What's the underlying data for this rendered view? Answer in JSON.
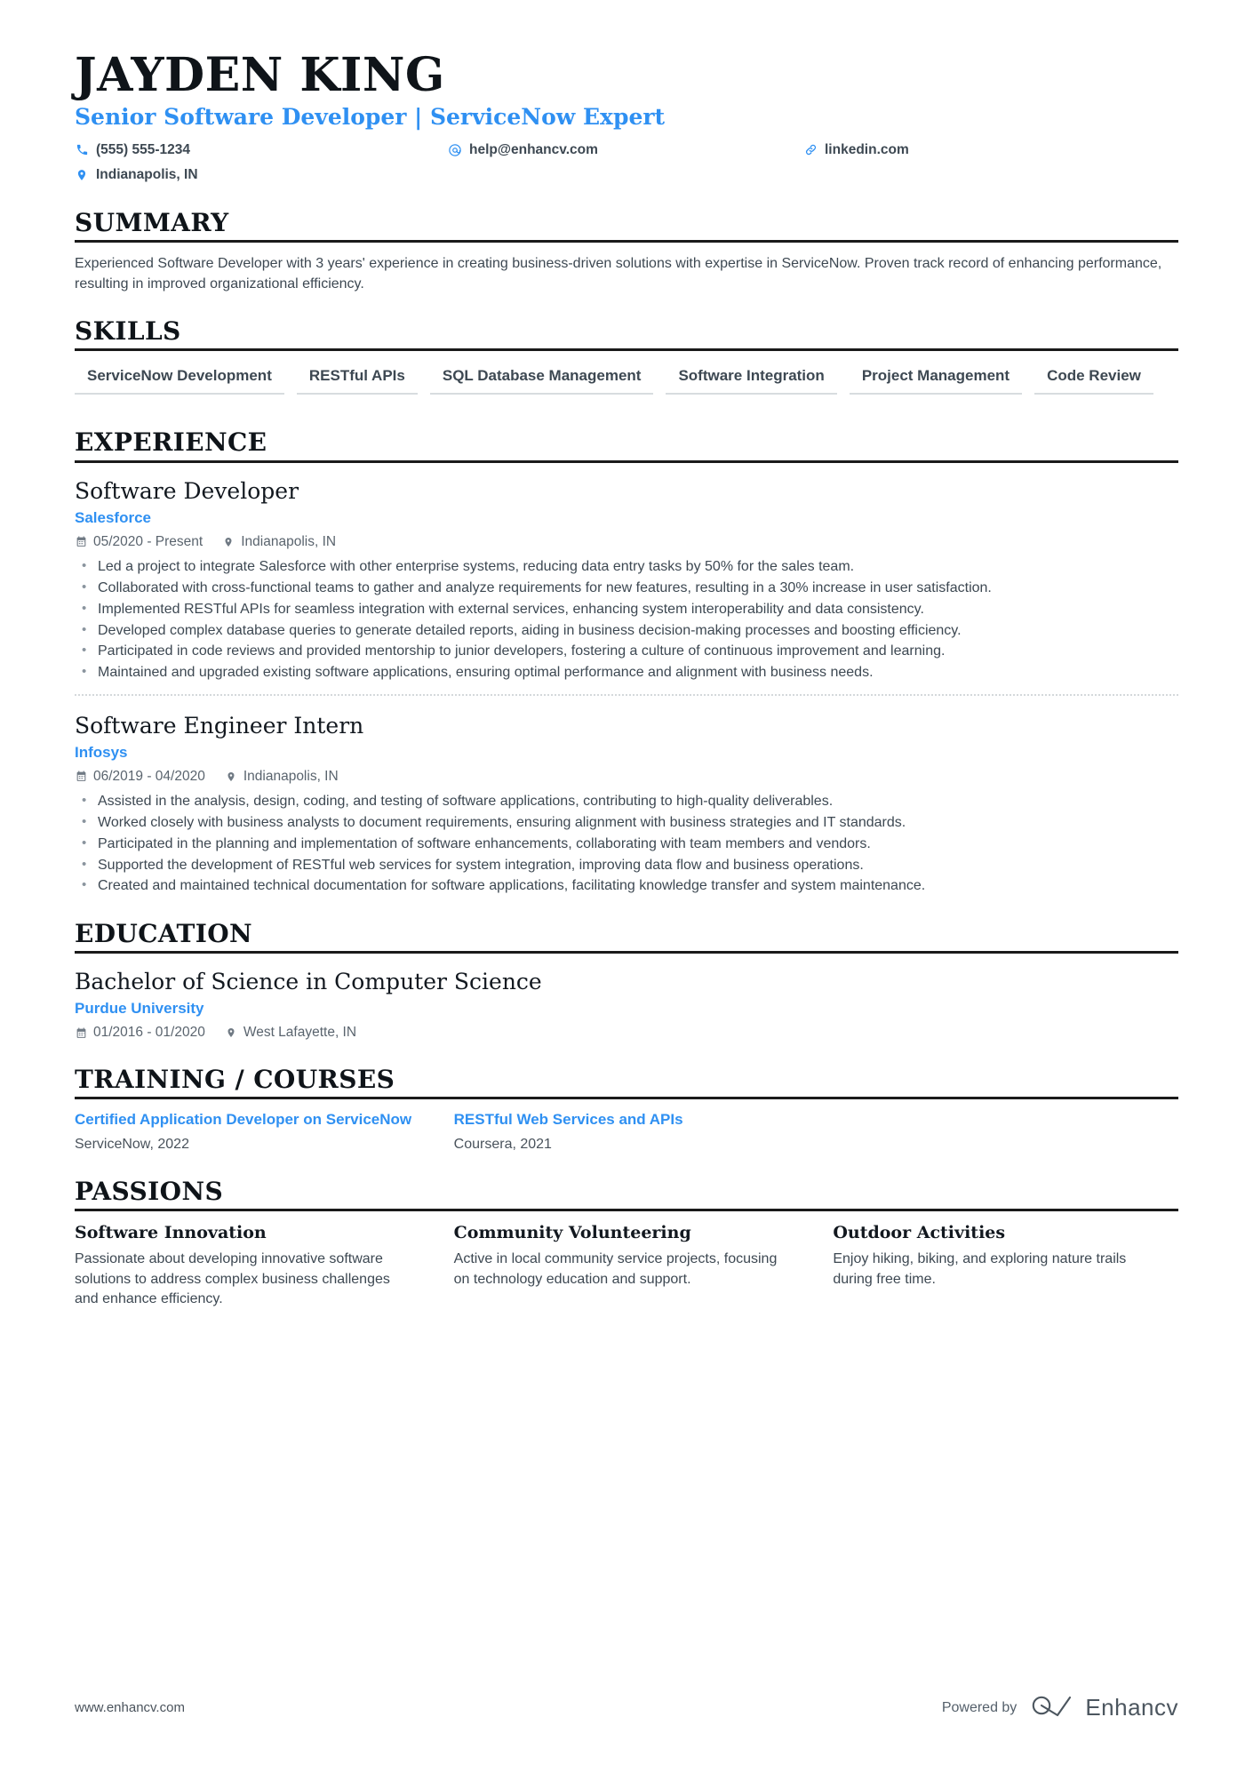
{
  "header": {
    "name": "JAYDEN KING",
    "tagline": "Senior Software Developer | ServiceNow Expert",
    "contacts": [
      {
        "icon": "phone-icon",
        "text": "(555) 555-1234"
      },
      {
        "icon": "email-icon",
        "text": "help@enhancv.com"
      },
      {
        "icon": "link-icon",
        "text": "linkedin.com"
      },
      {
        "icon": "location-icon",
        "text": "Indianapolis, IN"
      }
    ]
  },
  "summary": {
    "heading": "SUMMARY",
    "text": "Experienced Software Developer with 3 years' experience in creating business-driven solutions with expertise in ServiceNow. Proven track record of enhancing performance, resulting in improved organizational efficiency."
  },
  "skills": {
    "heading": "SKILLS",
    "items": [
      "ServiceNow Development",
      "RESTful APIs",
      "SQL Database Management",
      "Software Integration",
      "Project Management",
      "Code Review"
    ]
  },
  "experience": {
    "heading": "EXPERIENCE",
    "entries": [
      {
        "title": "Software Developer",
        "company": "Salesforce",
        "dates": "05/2020 - Present",
        "location": "Indianapolis, IN",
        "bullets": [
          "Led a project to integrate Salesforce with other enterprise systems, reducing data entry tasks by 50% for the sales team.",
          "Collaborated with cross-functional teams to gather and analyze requirements for new features, resulting in a 30% increase in user satisfaction.",
          "Implemented RESTful APIs for seamless integration with external services, enhancing system interoperability and data consistency.",
          "Developed complex database queries to generate detailed reports, aiding in business decision-making processes and boosting efficiency.",
          "Participated in code reviews and provided mentorship to junior developers, fostering a culture of continuous improvement and learning.",
          "Maintained and upgraded existing software applications, ensuring optimal performance and alignment with business needs."
        ]
      },
      {
        "title": "Software Engineer Intern",
        "company": "Infosys",
        "dates": "06/2019 - 04/2020",
        "location": "Indianapolis, IN",
        "bullets": [
          "Assisted in the analysis, design, coding, and testing of software applications, contributing to high-quality deliverables.",
          "Worked closely with business analysts to document requirements, ensuring alignment with business strategies and IT standards.",
          "Participated in the planning and implementation of software enhancements, collaborating with team members and vendors.",
          "Supported the development of RESTful web services for system integration, improving data flow and business operations.",
          "Created and maintained technical documentation for software applications, facilitating knowledge transfer and system maintenance."
        ]
      }
    ]
  },
  "education": {
    "heading": "EDUCATION",
    "entries": [
      {
        "degree": "Bachelor of Science in Computer Science",
        "school": "Purdue University",
        "dates": "01/2016 - 01/2020",
        "location": "West Lafayette, IN"
      }
    ]
  },
  "training": {
    "heading": "TRAINING / COURSES",
    "courses": [
      {
        "title": "Certified Application Developer on ServiceNow",
        "provider": "ServiceNow, 2022"
      },
      {
        "title": "RESTful Web Services and APIs",
        "provider": "Coursera, 2021"
      }
    ]
  },
  "passions": {
    "heading": "PASSIONS",
    "items": [
      {
        "title": "Software Innovation",
        "text": "Passionate about developing innovative software solutions to address complex business challenges and enhance efficiency."
      },
      {
        "title": "Community Volunteering",
        "text": "Active in local community service projects, focusing on technology education and support."
      },
      {
        "title": "Outdoor Activities",
        "text": "Enjoy hiking, biking, and exploring nature trails during free time."
      }
    ]
  },
  "footer": {
    "url": "www.enhancv.com",
    "powered_by": "Powered by",
    "brand": "Enhancv"
  },
  "colors": {
    "accent": "#2f90f2",
    "text": "#3d4852",
    "heading": "#0f1419",
    "rule": "#1a1a1a",
    "muted": "#5a646e"
  }
}
